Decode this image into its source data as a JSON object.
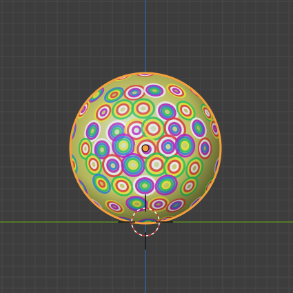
{
  "viewport": {
    "background_color": "#3d3d3d",
    "grid_minor_color": "#464646",
    "grid_major_color": "#4b4b4b",
    "x_axis_color": "#5c8a24",
    "z_axis_color": "#2f5f9e"
  },
  "scene": {
    "object": {
      "type": "sphere",
      "selected": true,
      "outline_color": "#f5a03c",
      "texture": "psychedelic-ring-pattern"
    },
    "origin_point": {
      "fill_color": "#f5a03c"
    },
    "cursor_3d": {
      "icon": "3d-cursor-icon"
    }
  }
}
